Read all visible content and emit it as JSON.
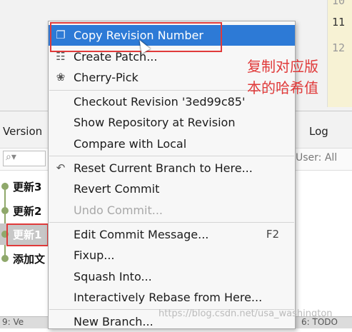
{
  "gutter": {
    "line_numbers": [
      "10",
      "11",
      "12"
    ]
  },
  "tabs": {
    "version": "Version",
    "log": "Log"
  },
  "filter": {
    "user_filter": "User: All"
  },
  "commits": [
    {
      "label": "更新3"
    },
    {
      "label": "更新2"
    },
    {
      "label": "更新1"
    },
    {
      "label": "添加文"
    }
  ],
  "menu": {
    "copy_revision": {
      "label": "Copy Revision Number",
      "icon": "copy-icon"
    },
    "create_patch": {
      "label": "Create Patch...",
      "icon": "patch-icon"
    },
    "cherry_pick": {
      "label": "Cherry-Pick",
      "icon": "cherry-icon"
    },
    "checkout_revision": {
      "label": "Checkout Revision '3ed99c85'"
    },
    "show_repository": {
      "label": "Show Repository at Revision"
    },
    "compare_local": {
      "label": "Compare with Local"
    },
    "reset_branch": {
      "label": "Reset Current Branch to Here...",
      "icon": "undo-icon"
    },
    "revert_commit": {
      "label": "Revert Commit"
    },
    "undo_commit": {
      "label": "Undo Commit..."
    },
    "edit_message": {
      "label": "Edit Commit Message...",
      "shortcut": "F2"
    },
    "fixup": {
      "label": "Fixup..."
    },
    "squash": {
      "label": "Squash Into..."
    },
    "rebase": {
      "label": "Interactively Rebase from Here..."
    },
    "new_branch": {
      "label": "New Branch..."
    }
  },
  "annotation": {
    "line1": "复制对应版",
    "line2": "本的哈希值"
  },
  "status": {
    "left": "9: Ve",
    "right": "6: TODO"
  },
  "watermark": "https://blog.csdn.net/usa_washington",
  "colors": {
    "highlight": "#2d7ad6",
    "annotation": "#e03a3a",
    "graph": "#8fa86b"
  }
}
